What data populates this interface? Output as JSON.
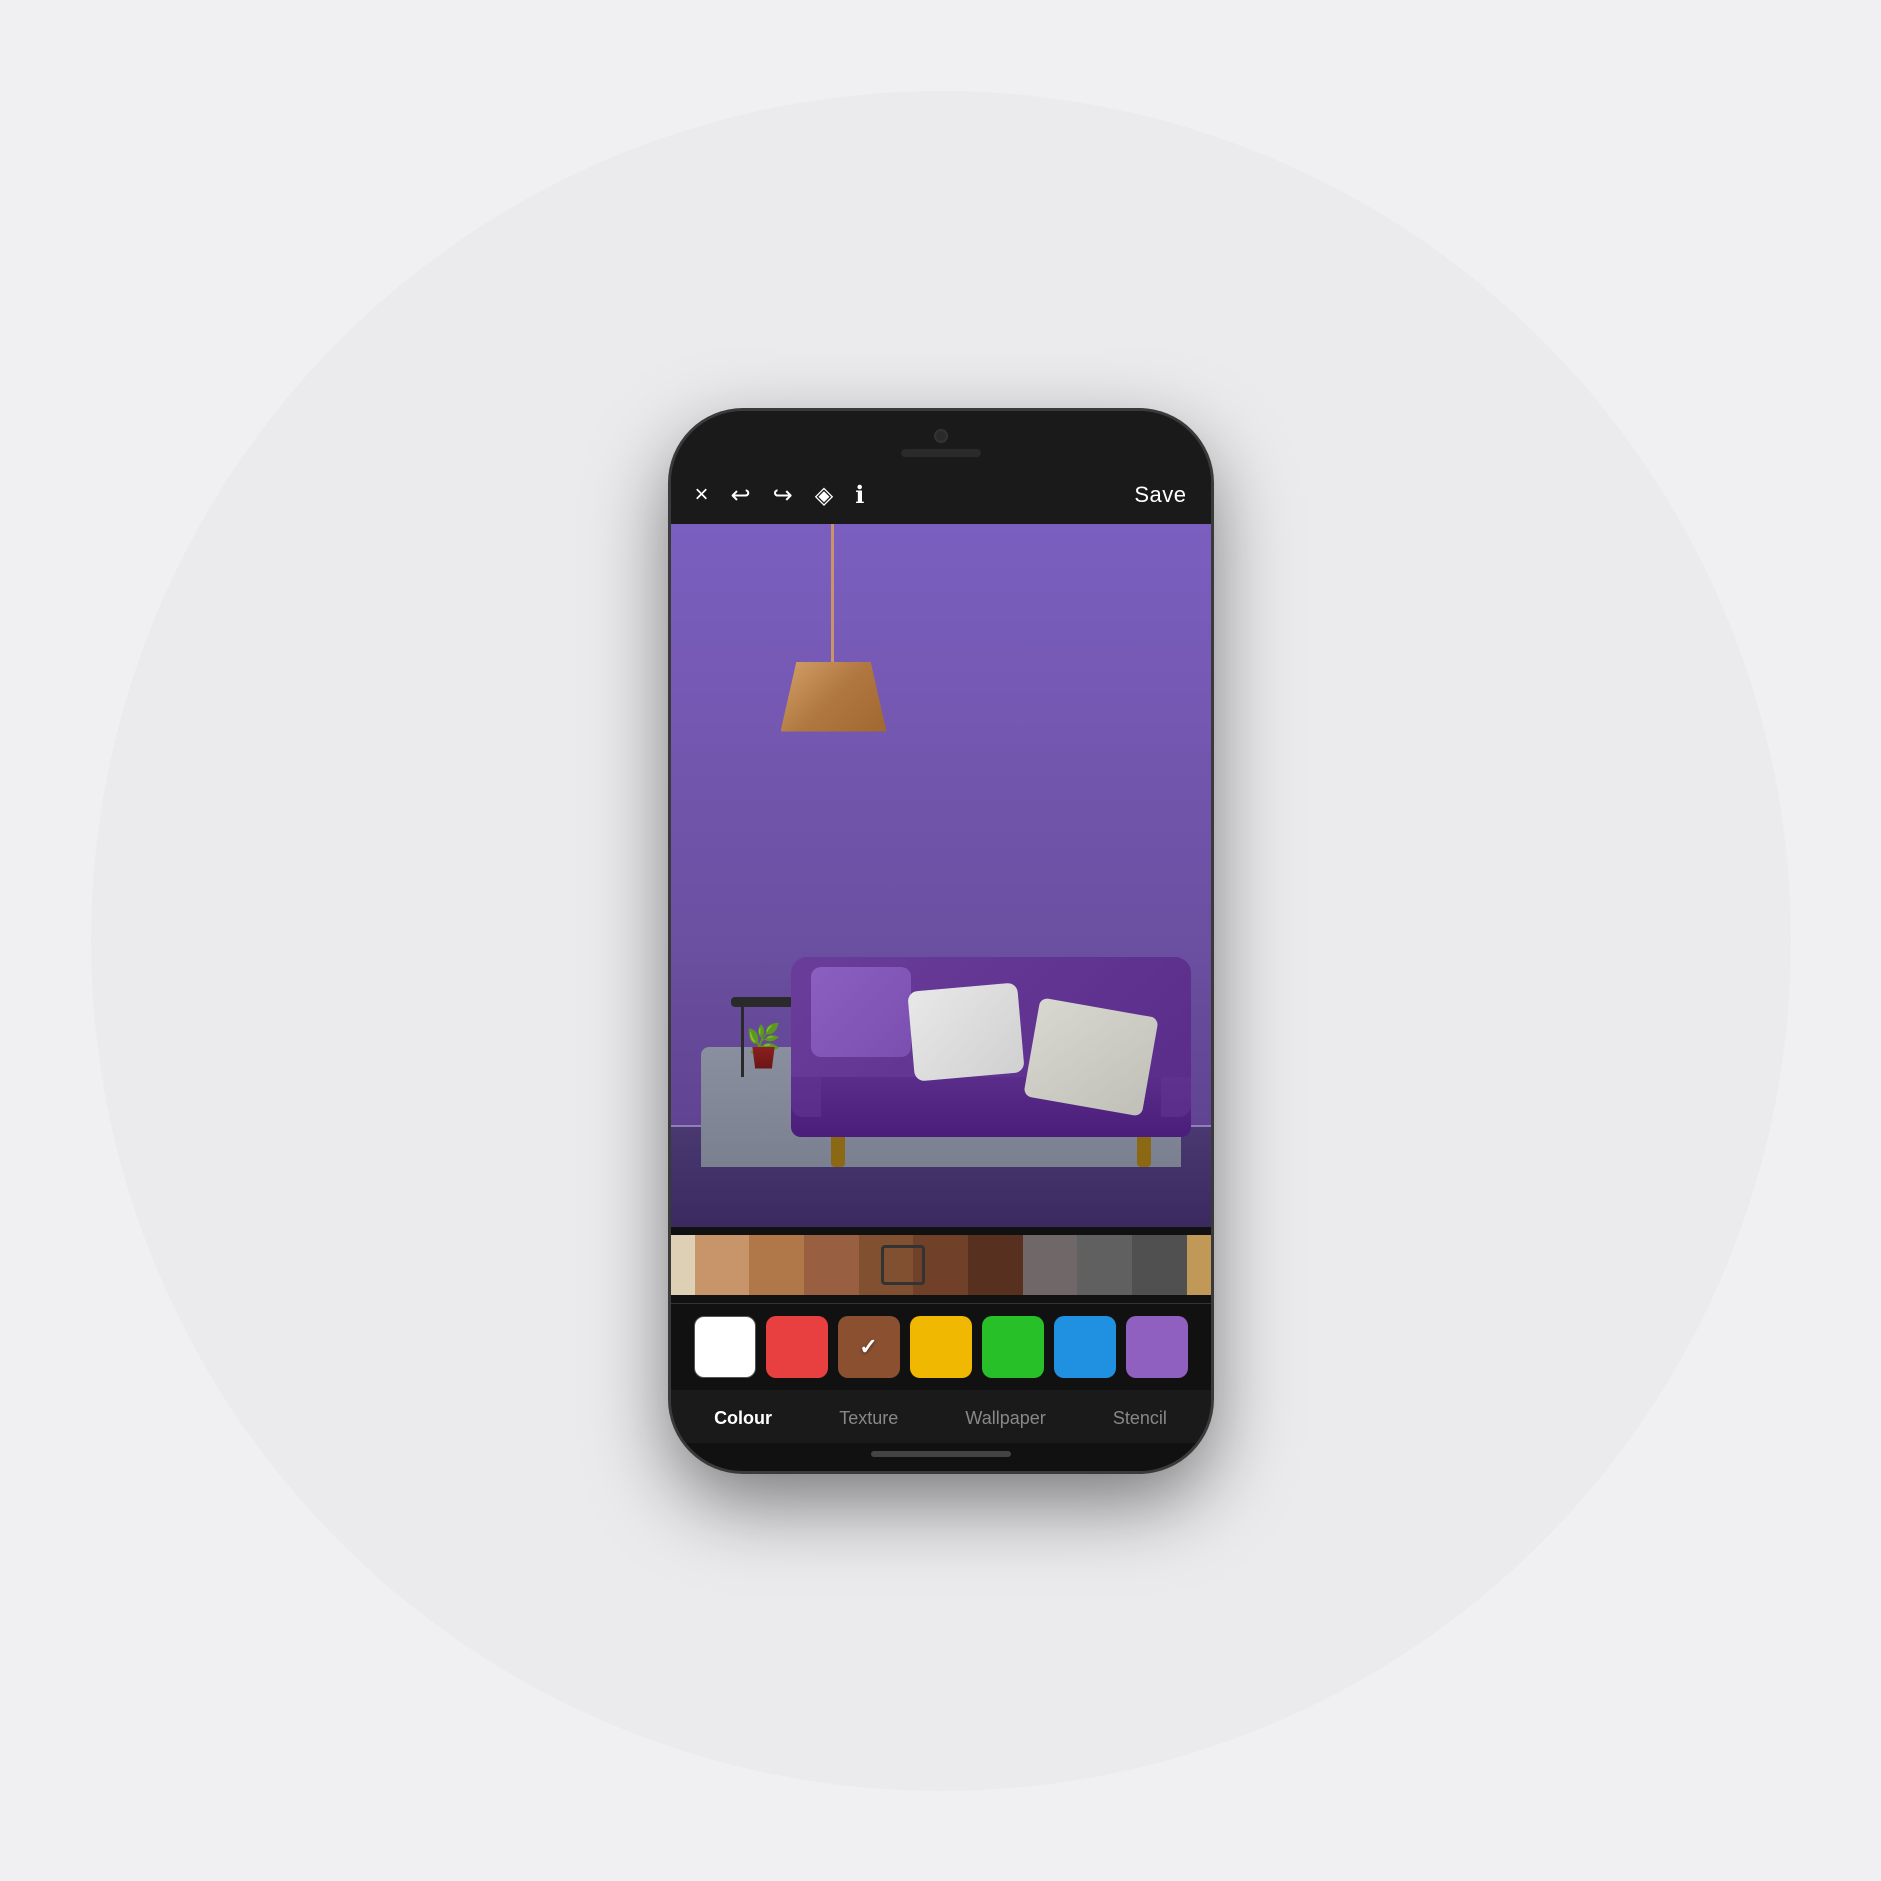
{
  "background": {
    "circle_color": "#ebebed"
  },
  "phone": {
    "toolbar": {
      "close_label": "×",
      "undo_label": "↩",
      "redo_label": "↪",
      "eraser_label": "◈",
      "info_label": "ℹ",
      "save_label": "Save"
    },
    "color_strip": {
      "colors": [
        "#c8956a",
        "#a07040",
        "#8a6030",
        "#6a4820",
        "#505050",
        "#404040",
        "#303030",
        "#808070",
        "#c0a870"
      ]
    },
    "palette": {
      "swatches": [
        {
          "color": "#ffffff",
          "selected": false,
          "label": "white"
        },
        {
          "color": "#e84040",
          "selected": false,
          "label": "red"
        },
        {
          "color": "#8B5030",
          "selected": true,
          "label": "brown"
        },
        {
          "color": "#f0b800",
          "selected": false,
          "label": "yellow"
        },
        {
          "color": "#28c028",
          "selected": false,
          "label": "green"
        },
        {
          "color": "#2090e0",
          "selected": false,
          "label": "blue"
        },
        {
          "color": "#9060c0",
          "selected": false,
          "label": "purple"
        }
      ]
    },
    "bottom_nav": {
      "tabs": [
        {
          "label": "Colour",
          "active": true
        },
        {
          "label": "Texture",
          "active": false
        },
        {
          "label": "Wallpaper",
          "active": false
        },
        {
          "label": "Stencil",
          "active": false
        }
      ]
    }
  }
}
